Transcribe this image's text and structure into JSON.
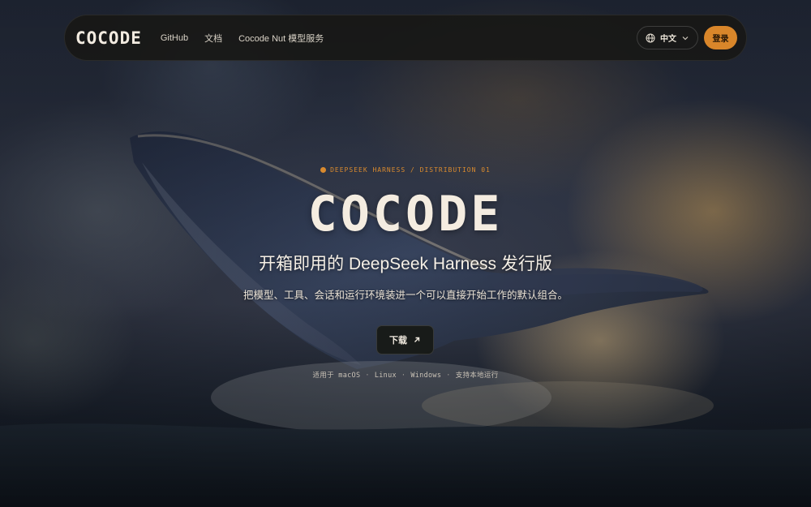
{
  "nav": {
    "logo": "COCODE",
    "links": [
      "GitHub",
      "文档",
      "Cocode Nut 模型服务"
    ],
    "language": "中文",
    "login_label": "登录"
  },
  "hero": {
    "eyebrow": "DEEPSEEK HARNESS / DISTRIBUTION 01",
    "title": "COCODE",
    "subtitle": "开箱即用的 DeepSeek Harness 发行版",
    "description": "把模型、工具、会话和运行环境装进一个可以直接开始工作的默认组合。",
    "download_label": "下载",
    "platforms": [
      "适用于 macOS",
      "Linux",
      "Windows",
      "支持本地运行"
    ]
  },
  "colors": {
    "accent": "#d9862a",
    "navbar_bg": "#181816",
    "text": "#f3ece1"
  },
  "icons": {
    "language": "globe-icon",
    "dropdown": "chevron-down-icon",
    "download": "arrow-up-right-icon"
  }
}
